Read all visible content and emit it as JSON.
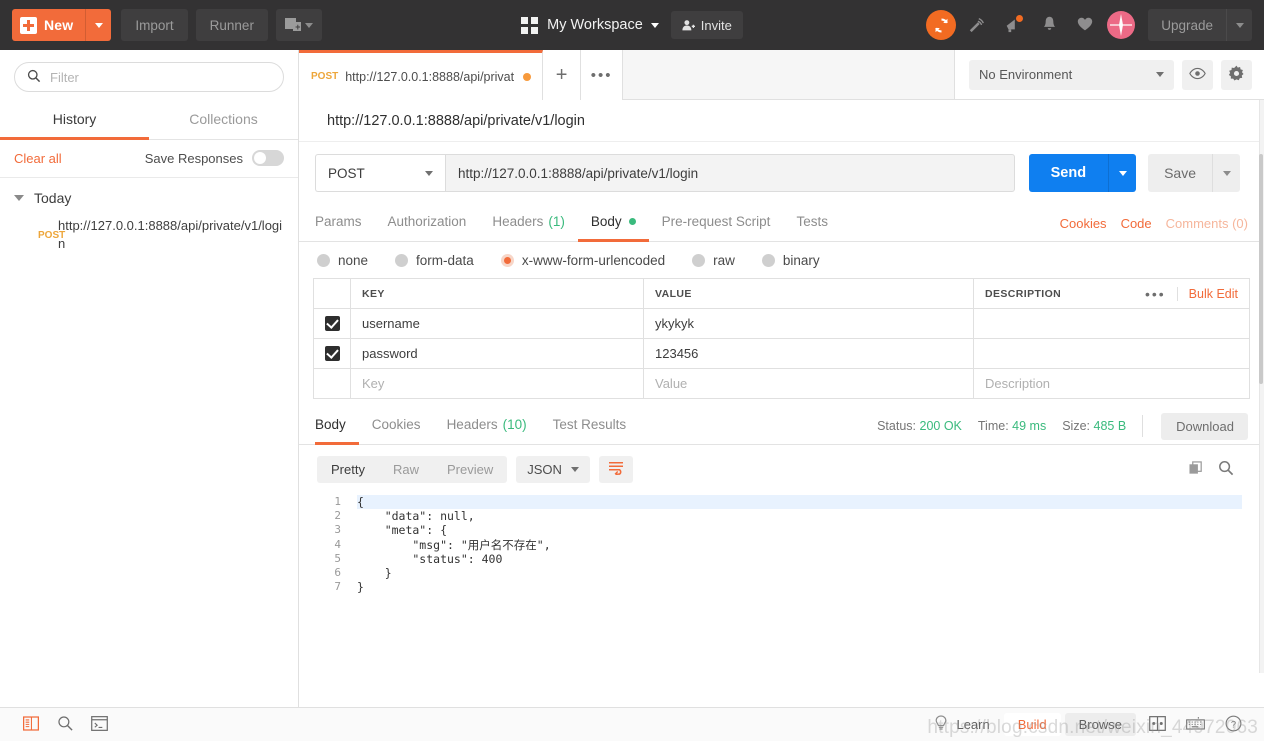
{
  "topbar": {
    "new_label": "New",
    "import_label": "Import",
    "runner_label": "Runner",
    "workspace_name": "My Workspace",
    "invite_label": "Invite",
    "upgrade_label": "Upgrade",
    "icons": [
      "sync-icon",
      "satellite-icon",
      "megaphone-icon",
      "bell-icon",
      "heart-icon",
      "avatar-icon"
    ],
    "accent": "#f26b3a"
  },
  "sidebar": {
    "filter_placeholder": "Filter",
    "tabs": [
      {
        "label": "History",
        "active": true
      },
      {
        "label": "Collections",
        "active": false
      }
    ],
    "clear_all": "Clear all",
    "save_responses": "Save Responses",
    "save_responses_on": false,
    "group_label": "Today",
    "history": [
      {
        "method": "POST",
        "url": "http://127.0.0.1:8888/api/private/v1/login"
      }
    ]
  },
  "request_tabs": {
    "tabs": [
      {
        "method": "POST",
        "url": "http://127.0.0.1:8888/api/privat",
        "unsaved": true,
        "active": true
      }
    ],
    "new_tab": "+",
    "more": "•••"
  },
  "environment": {
    "selected": "No Environment",
    "eye_icon": "eye-icon",
    "gear_icon": "gear-icon"
  },
  "request": {
    "title": "http://127.0.0.1:8888/api/private/v1/login",
    "method": "POST",
    "url": "http://127.0.0.1:8888/api/private/v1/login",
    "send_label": "Send",
    "save_label": "Save",
    "tabs": [
      {
        "label": "Params",
        "active": false
      },
      {
        "label": "Authorization",
        "active": false
      },
      {
        "label": "Headers",
        "count": "(1)",
        "active": false
      },
      {
        "label": "Body",
        "dot": true,
        "active": true
      },
      {
        "label": "Pre-request Script",
        "active": false
      },
      {
        "label": "Tests",
        "active": false
      }
    ],
    "links": [
      {
        "label": "Cookies",
        "muted": false
      },
      {
        "label": "Code",
        "muted": false
      },
      {
        "label": "Comments (0)",
        "muted": true
      }
    ],
    "body_types": [
      {
        "label": "none",
        "selected": false
      },
      {
        "label": "form-data",
        "selected": false
      },
      {
        "label": "x-www-form-urlencoded",
        "selected": true
      },
      {
        "label": "raw",
        "selected": false
      },
      {
        "label": "binary",
        "selected": false
      }
    ],
    "table": {
      "headers": {
        "key": "KEY",
        "value": "VALUE",
        "description": "DESCRIPTION"
      },
      "bulk_edit": "Bulk Edit",
      "more": "•••",
      "rows": [
        {
          "checked": true,
          "key": "username",
          "value": "ykykyk",
          "description": ""
        },
        {
          "checked": true,
          "key": "password",
          "value": "123456",
          "description": ""
        }
      ],
      "placeholder_row": {
        "key": "Key",
        "value": "Value",
        "description": "Description"
      }
    }
  },
  "response": {
    "tabs": [
      {
        "label": "Body",
        "active": true
      },
      {
        "label": "Cookies",
        "active": false
      },
      {
        "label": "Headers",
        "count": "(10)",
        "active": false
      },
      {
        "label": "Test Results",
        "active": false
      }
    ],
    "status_label": "Status:",
    "status_value": "200 OK",
    "time_label": "Time:",
    "time_value": "49 ms",
    "size_label": "Size:",
    "size_value": "485 B",
    "download_label": "Download",
    "view_modes": [
      {
        "label": "Pretty",
        "active": true
      },
      {
        "label": "Raw",
        "active": false
      },
      {
        "label": "Preview",
        "active": false
      }
    ],
    "format": "JSON",
    "wrap_icon": "wrap-lines-icon",
    "copy_icon": "copy-icon",
    "search_icon": "search-icon",
    "code_lines": [
      {
        "n": "1",
        "fold": true,
        "text": "{",
        "highlight": true
      },
      {
        "n": "2",
        "fold": false,
        "text": "    \"data\": null,"
      },
      {
        "n": "3",
        "fold": true,
        "text": "    \"meta\": {"
      },
      {
        "n": "4",
        "fold": false,
        "text": "        \"msg\": \"用户名不存在\","
      },
      {
        "n": "5",
        "fold": false,
        "text": "        \"status\": 400"
      },
      {
        "n": "6",
        "fold": false,
        "text": "    }"
      },
      {
        "n": "7",
        "fold": false,
        "text": "}"
      }
    ]
  },
  "footer": {
    "left_icons": [
      "sidebar-toggle-icon",
      "find-icon",
      "console-icon"
    ],
    "learn_label": "Learn",
    "build_label": "Build",
    "browse_label": "Browse",
    "right_icons": [
      "two-pane-icon",
      "keyboard-icon",
      "help-icon"
    ]
  },
  "watermark": "https://blog.csdn.net/weixin_44972063"
}
